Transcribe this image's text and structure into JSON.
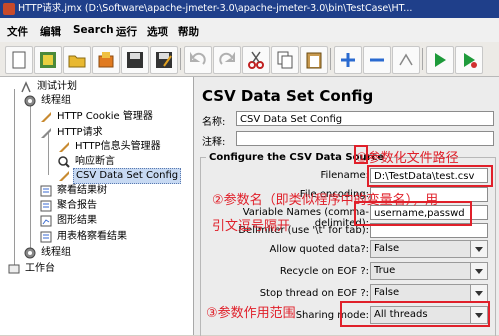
{
  "window": {
    "title": "HTTP请求.jmx (D:\\Software\\apache-jmeter-3.0\\apache-jmeter-3.0\\bin\\TestCase\\HT..."
  },
  "menu": [
    "文件",
    "编辑",
    "Search",
    "运行",
    "选项",
    "帮助"
  ],
  "toolbar": [
    "new-icon",
    "templates-icon",
    "open-icon",
    "close-icon",
    "save-icon",
    "save-as-icon",
    "undo-icon",
    "redo-icon",
    "cut-icon",
    "copy-icon",
    "paste-icon",
    "expand-icon",
    "collapse-icon",
    "toggle-icon",
    "start-icon",
    "start-no-pause-icon"
  ],
  "tree": {
    "items": [
      {
        "label": "测试计划",
        "icon": "test-plan-icon"
      },
      {
        "label": "线程组",
        "icon": "thread-group-icon"
      },
      {
        "label": "HTTP Cookie 管理器",
        "icon": "config-icon"
      },
      {
        "label": "HTTP请求",
        "icon": "sampler-icon"
      },
      {
        "label": "HTTP信息头管理器",
        "icon": "config-icon"
      },
      {
        "label": "响应断言",
        "icon": "assertion-icon"
      },
      {
        "label": "CSV Data Set Config",
        "icon": "config-icon",
        "selected": true
      },
      {
        "label": "察看结果树",
        "icon": "listener-icon"
      },
      {
        "label": "聚合报告",
        "icon": "listener-icon"
      },
      {
        "label": "图形结果",
        "icon": "listener-icon"
      },
      {
        "label": "用表格察看结果",
        "icon": "listener-icon"
      },
      {
        "label": "线程组",
        "icon": "thread-group-icon"
      },
      {
        "label": "工作台",
        "icon": "workbench-icon"
      }
    ]
  },
  "config": {
    "title": "CSV Data Set Config",
    "name_label": "名称:",
    "name_value": "CSV Data Set Config",
    "comment_label": "注释:",
    "group_title": "Configure the CSV Data Source",
    "filename_label": "Filename:",
    "filename_value": "D:\\TestData\\test.csv",
    "encoding_label": "File encoding:",
    "varnames_label": "Variable Names (comma-delimited):",
    "varnames_value": "username,passwd",
    "delimiter_label": "Delimiter (use '\\t' for tab):",
    "quoted_label": "Allow quoted data?:",
    "quoted_value": "False",
    "recycle_label": "Recycle on EOF ?:",
    "recycle_value": "True",
    "stop_label": "Stop thread on EOF ?:",
    "stop_value": "False",
    "sharing_label": "Sharing mode:",
    "sharing_value": "All threads"
  },
  "annotations": {
    "a1": "①参数化文件路径",
    "a2": "②参数名（即类似程序中的变量名），用",
    "a2b": "引文逗号隔开",
    "a3": "③参数作用范围"
  },
  "colors": {
    "annotation": "#e0202a",
    "titlebar": "#1f3f8a",
    "selection": "#c7d9f2"
  }
}
